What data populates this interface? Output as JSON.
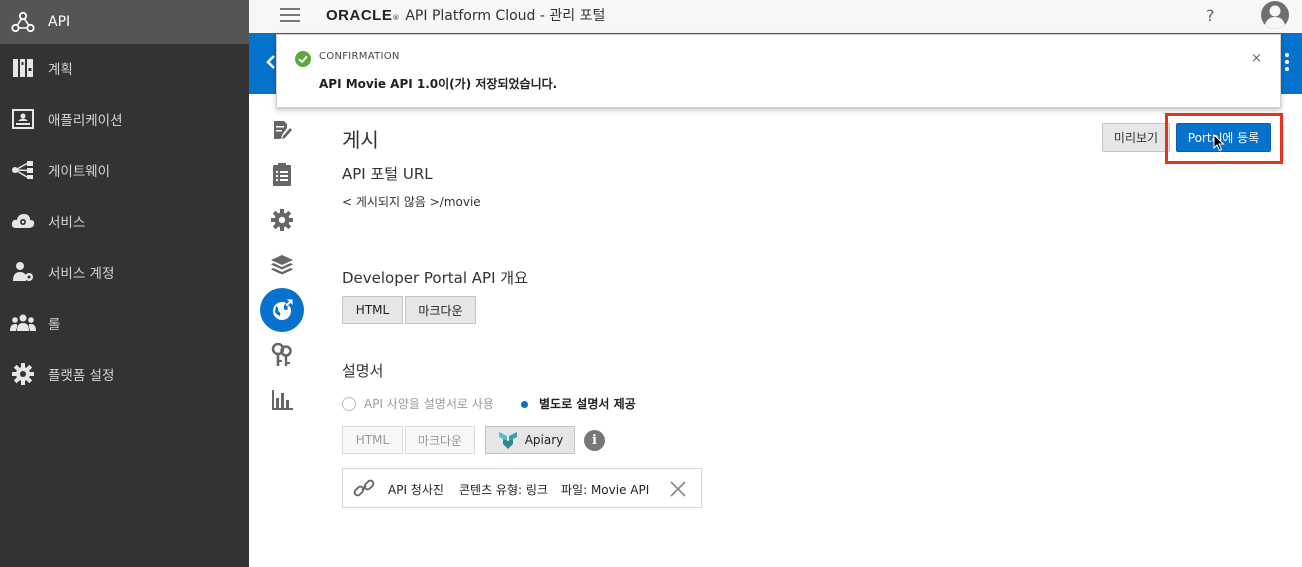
{
  "sidebar": {
    "items": [
      {
        "label": "API",
        "icon": "api-icon",
        "active": true
      },
      {
        "label": "계획",
        "icon": "plans-icon"
      },
      {
        "label": "애플리케이션",
        "icon": "applications-icon"
      },
      {
        "label": "게이트웨이",
        "icon": "gateways-icon"
      },
      {
        "label": "서비스",
        "icon": "services-icon"
      },
      {
        "label": "서비스 계정",
        "icon": "service-accounts-icon"
      },
      {
        "label": "롤",
        "icon": "roles-icon"
      },
      {
        "label": "플랫폼 설정",
        "icon": "platform-settings-icon"
      }
    ]
  },
  "header": {
    "oracle": "ORACLE",
    "reg": "®",
    "title": "API Platform Cloud - 관리 포털",
    "help": "?"
  },
  "toast": {
    "heading": "CONFIRMATION",
    "message": "API Movie API 1.0이(가) 저장되었습니다.",
    "close": "×"
  },
  "main": {
    "title": "게시",
    "preview_button": "미리보기",
    "register_button": "Portal에 등록",
    "portal_url": {
      "heading": "API 포털 URL",
      "value": "< 게시되지 않음 >/movie"
    },
    "overview": {
      "heading": "Developer Portal API 개요",
      "options": [
        "HTML",
        "마크다운"
      ]
    },
    "documentation": {
      "heading": "설명서",
      "radio_spec": "API 사양을 설명서로 사용",
      "radio_separate": "별도로 설명서 제공",
      "options": [
        "HTML",
        "마크다운",
        "Apiary"
      ],
      "info": "i",
      "link": {
        "name": "API 청사진",
        "content_type": "콘텐츠 유형: 링크",
        "file": "파일: Movie API"
      }
    }
  },
  "colors": {
    "sidebar_bg": "#333333",
    "sidebar_active": "#555555",
    "accent_blue": "#0572ce",
    "highlight_red": "#e8321c",
    "success_green": "#5aa93c"
  }
}
